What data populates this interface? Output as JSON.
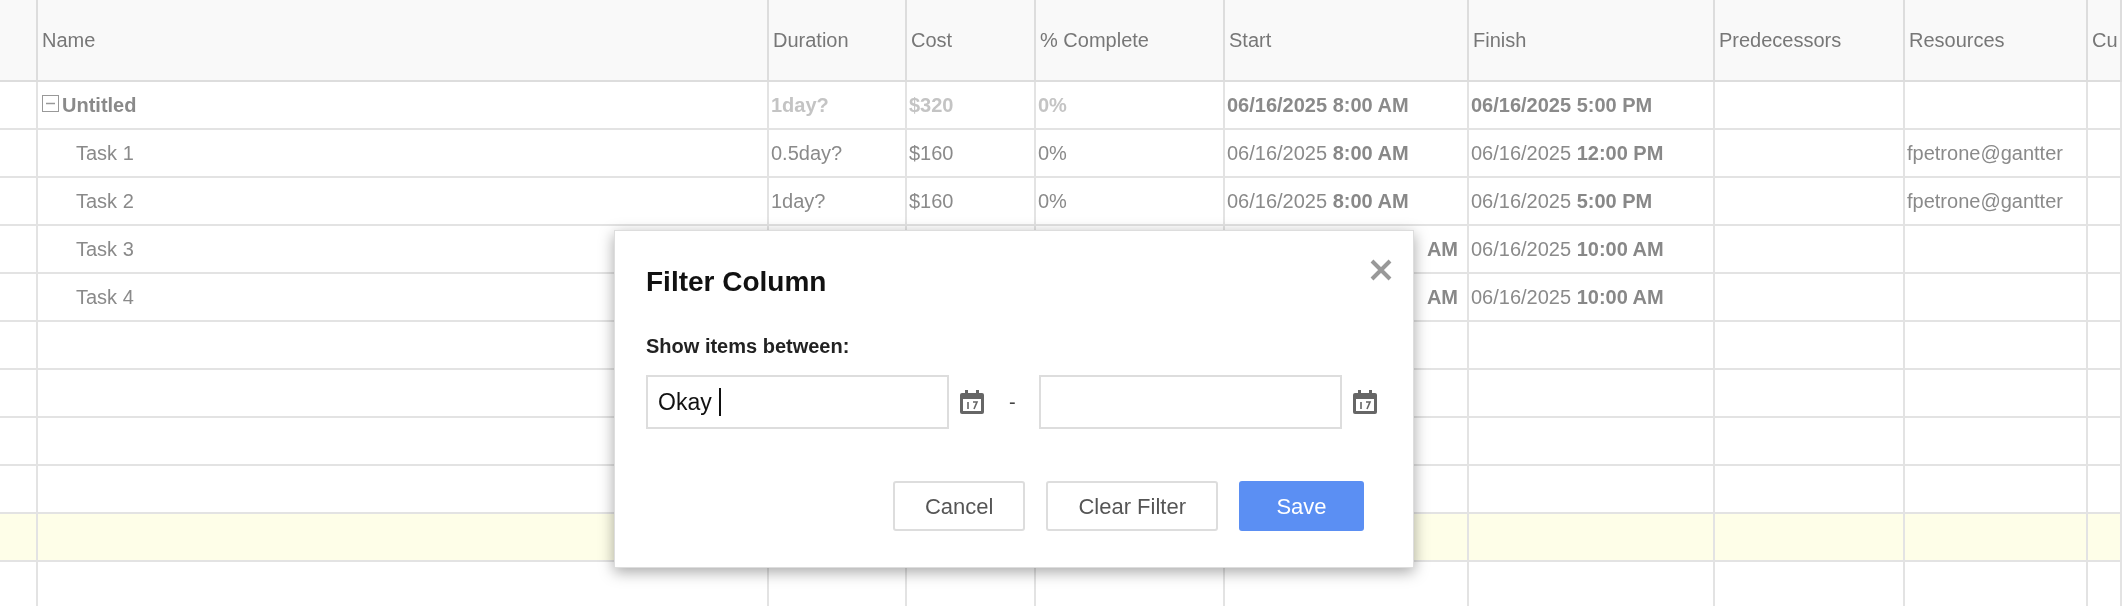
{
  "table": {
    "columns": [
      "Name",
      "Duration",
      "Cost",
      "% Complete",
      "Start",
      "Finish",
      "Predecessors",
      "Resources",
      "Cu"
    ],
    "rows": [
      {
        "kind": "summary",
        "expanded": true,
        "selected": false,
        "name": "Untitled",
        "duration": "1day?",
        "cost": "$320",
        "complete": "0%",
        "start": "06/16/2025 8:00 AM",
        "finish": "06/16/2025 5:00 PM"
      },
      {
        "kind": "task",
        "selected": false,
        "name": "Task 1",
        "duration": "0.5day?",
        "cost": "$160",
        "complete": "0%",
        "start": "06/16/2025 **8:00 AM**",
        "finish": "06/16/2025 **12:00 PM**",
        "resources": "fpetrone@gantter"
      },
      {
        "kind": "task",
        "selected": false,
        "name": "Task 2",
        "duration": "1day?",
        "cost": "$160",
        "complete": "0%",
        "start": "06/16/2025 **8:00 AM**",
        "finish": "06/16/2025 **5:00 PM**",
        "resources": "fpetrone@gantter"
      },
      {
        "kind": "task",
        "selected": false,
        "covered": true,
        "name": "Task 3",
        "start": "**AM**",
        "finish": "06/16/2025 **10:00 AM**"
      },
      {
        "kind": "task",
        "selected": false,
        "covered": true,
        "name": "Task 4",
        "start": "**AM**",
        "finish": "06/16/2025 **10:00 AM**"
      },
      {
        "kind": "empty",
        "selected": false
      },
      {
        "kind": "empty",
        "selected": false
      },
      {
        "kind": "empty",
        "selected": false
      },
      {
        "kind": "empty",
        "selected": false
      },
      {
        "kind": "empty",
        "selected": true
      },
      {
        "kind": "empty",
        "selected": false
      }
    ]
  },
  "dialog": {
    "title": "Filter Column",
    "label": "Show items between:",
    "from": {
      "value": "Okay",
      "focused": true
    },
    "separator": "-",
    "to": {
      "focused": false
    },
    "buttons": [
      {
        "label": "Cancel",
        "kind": "default"
      },
      {
        "label": "Clear Filter",
        "kind": "default"
      },
      {
        "label": "Save",
        "kind": "primary"
      }
    ]
  }
}
